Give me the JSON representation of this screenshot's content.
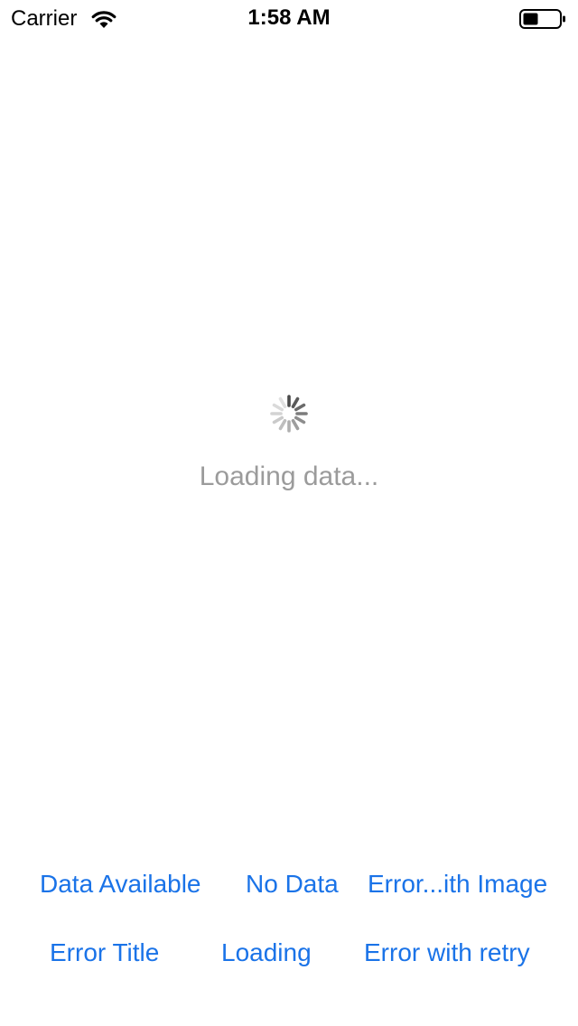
{
  "status_bar": {
    "carrier": "Carrier",
    "time": "1:58 AM",
    "icons": [
      "wifi-icon",
      "battery-icon"
    ]
  },
  "main": {
    "loading_text": "Loading data...",
    "spinner_icon": "activity-indicator-icon"
  },
  "buttons": {
    "data_available": "Data Available",
    "no_data": "No Data",
    "error_with_image": "Error...ith Image",
    "error_title": "Error Title",
    "loading": "Loading",
    "error_with_retry": "Error with retry"
  },
  "colors": {
    "tint": "#1a73e8",
    "loading_text": "#9b9b9b"
  }
}
